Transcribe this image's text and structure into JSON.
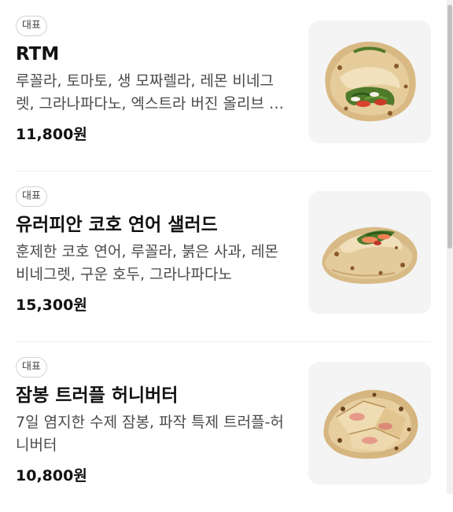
{
  "menu": {
    "items": [
      {
        "badge": "대표",
        "name": "RTM",
        "description": "루꼴라, 토마토, 생 모짜렐라, 레몬 비네그렛, 그라나파다노, 엑스트라 버진 올리브 오일",
        "price": "11,800원",
        "image_icon": "folded-flatbread-sandwich-image"
      },
      {
        "badge": "대표",
        "name": "유러피안 코호 연어 샐러드",
        "description": "훈제한 코호 연어, 루꼴라, 붉은 사과, 레몬 비네그렛, 구운 호두, 그라나파다노",
        "price": "15,300원",
        "image_icon": "salmon-salad-flatbread-image"
      },
      {
        "badge": "대표",
        "name": "잠봉 트러플 허니버터",
        "description": "7일 염지한 수제 잠봉, 파작 특제 트러플-허니버터",
        "price": "10,800원",
        "image_icon": "jambon-flatbread-image"
      }
    ]
  }
}
